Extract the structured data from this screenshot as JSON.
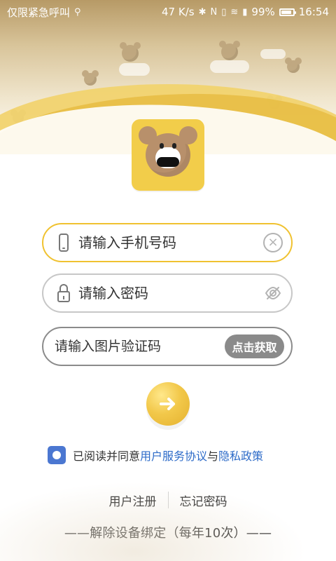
{
  "status_bar": {
    "left_text": "仅限紧急呼叫",
    "speed": "47 K/s",
    "battery": "99%",
    "time": "16:54"
  },
  "form": {
    "phone_placeholder": "请输入手机号码",
    "password_placeholder": "请输入密码",
    "captcha_placeholder": "请输入图片验证码",
    "get_code_label": "点击获取"
  },
  "agreement": {
    "prefix": "已阅读并同意",
    "link_terms": "用户服务协议",
    "middle": "与",
    "link_privacy": "隐私政策"
  },
  "links": {
    "register": "用户注册",
    "forgot": "忘记密码"
  },
  "unbind": "——解除设备绑定（每年10次）——",
  "icons": {
    "phone": "phone-icon",
    "lock": "lock-icon",
    "clear": "clear-icon",
    "eye_off": "eye-off-icon",
    "submit": "arrow-right-icon"
  },
  "colors": {
    "accent": "#f0c230",
    "link": "#2d6bc8",
    "checkbox": "#4b77d1",
    "button_gray": "#8a8a8a"
  }
}
